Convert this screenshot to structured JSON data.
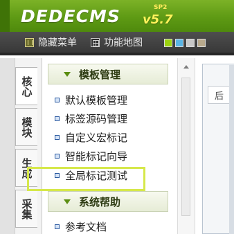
{
  "header": {
    "logo_text": "DEDECMS",
    "version": "v5.7",
    "edition": "SP2"
  },
  "toolbar": {
    "hide_menu_label": "隐藏菜单",
    "sitemap_label": "功能地图",
    "skin_swatches": [
      "#9bd20f",
      "#59b4e4",
      "#c8c8c8",
      "#b8a98c"
    ]
  },
  "left_tabs": [
    {
      "label": "核心"
    },
    {
      "label": "模块"
    },
    {
      "label": "生成"
    },
    {
      "label": "采集"
    }
  ],
  "menu": {
    "template_section": {
      "title": "模板管理",
      "items": [
        "默认模板管理",
        "标签源码管理",
        "自定义宏标记",
        "智能标记向导",
        "全局标记测试"
      ]
    },
    "help_section": {
      "title": "系统帮助",
      "items": [
        "参考文档"
      ]
    }
  },
  "right_area": {
    "tab_char": "后"
  },
  "colors": {
    "header_green": "#5e9a14",
    "toolbar_dark": "#3e3e3e",
    "highlight": "#d6e84a"
  }
}
